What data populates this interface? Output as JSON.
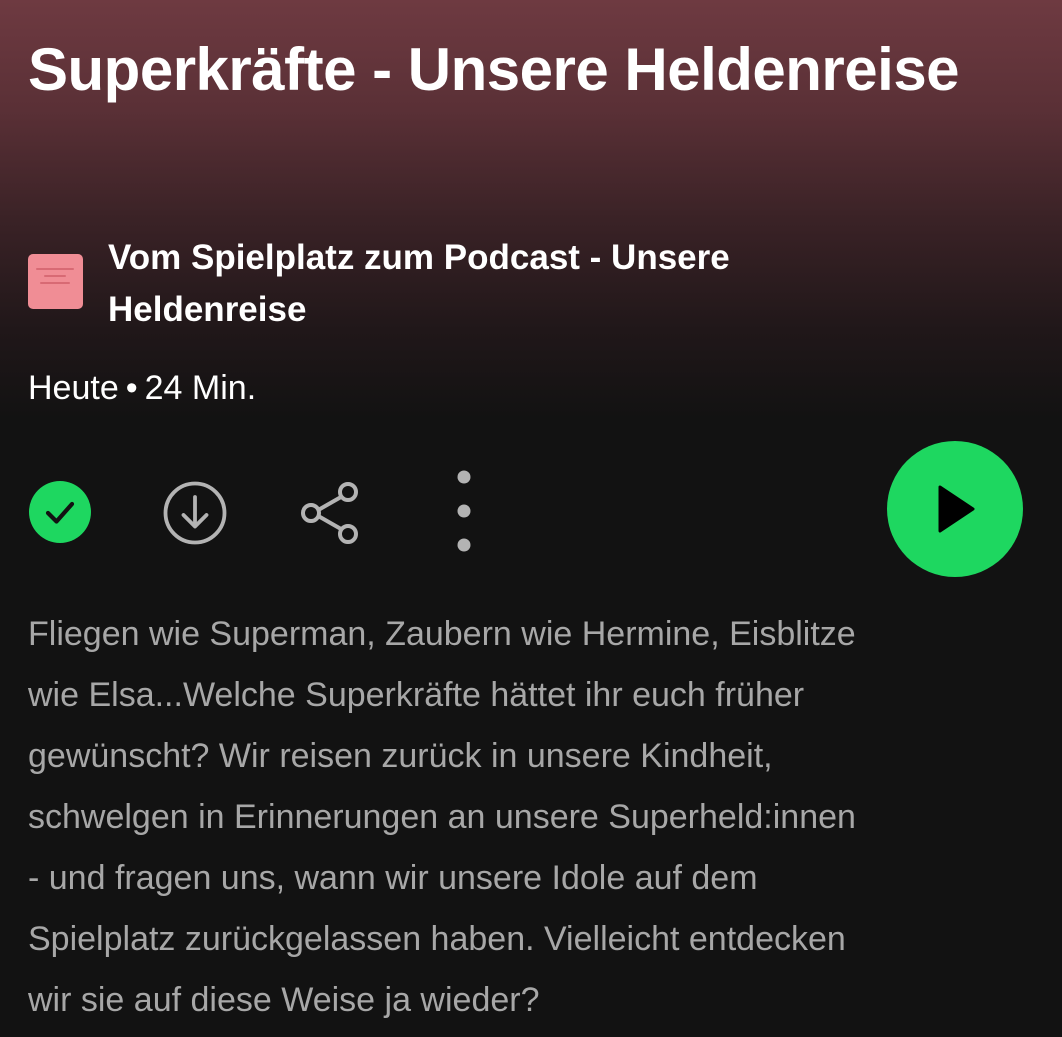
{
  "episode": {
    "title": "Superkräfte - Unsere Heldenreise",
    "show_name": "Vom Spielplatz zum Podcast - Unsere Heldenreise",
    "release": "Heute",
    "separator": "•",
    "duration": "24 Min.",
    "description": "Fliegen wie Superman, Zaubern wie Hermine, Eisblitze\nwie Elsa...Welche Superkräfte hättet ihr euch früher\ngewünscht? Wir reisen zurück in unsere Kindheit,\nschwelgen in Erinnerungen an unsere Superheld:innen\n- und fragen uns, wann wir unsere Idole auf dem\nSpielplatz zurückgelassen haben. Vielleicht entdecken\nwir sie auf diese Weise ja wieder?"
  },
  "actions": {
    "added": {
      "icon": "check-circle-icon",
      "state": "added",
      "color": "#1ed760"
    },
    "download": {
      "icon": "download-circle-icon"
    },
    "share": {
      "icon": "share-icon"
    },
    "more": {
      "icon": "more-vertical-icon"
    },
    "play": {
      "icon": "play-icon",
      "color": "#1ed760"
    }
  },
  "colors": {
    "accent": "#1ed760",
    "background": "#121212",
    "header_gradient_top": "#6e3a41",
    "secondary_text": "#a7a7a7",
    "cover": "#f08d95"
  }
}
